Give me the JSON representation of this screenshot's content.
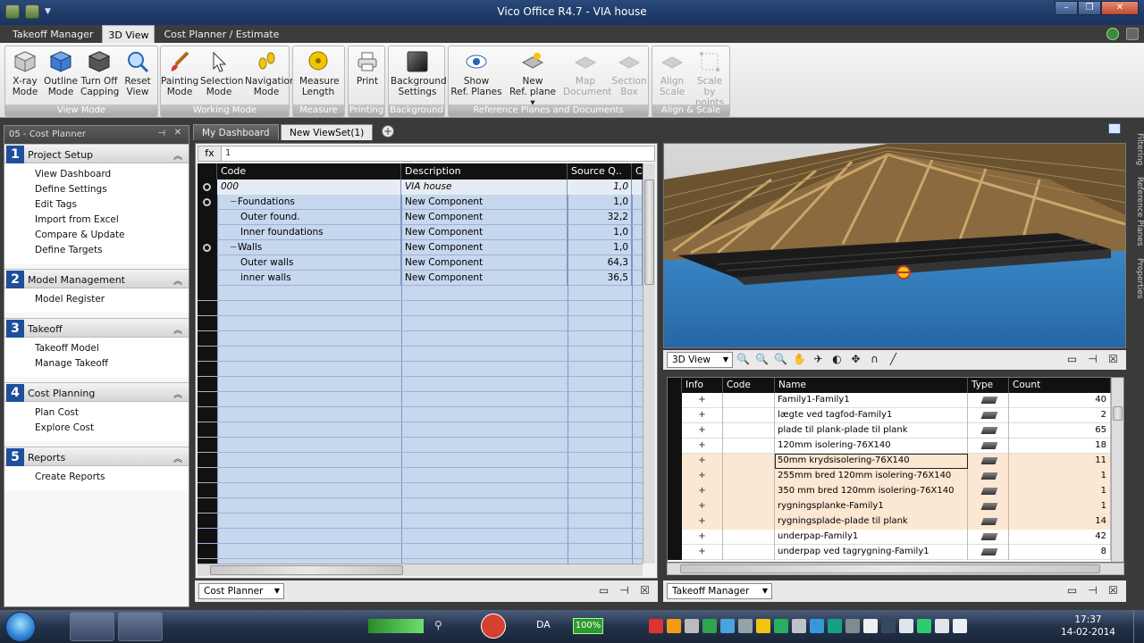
{
  "window": {
    "title": "Vico Office R4.7 - VIA house"
  },
  "menu_tabs": [
    {
      "label": "Takeoff Manager"
    },
    {
      "label": "3D View"
    },
    {
      "label": "Cost Planner / Estimate"
    }
  ],
  "ribbon": {
    "groups": [
      {
        "label": "View Mode",
        "buttons": [
          {
            "line1": "X-ray",
            "line2": "Mode",
            "icon": "xray-cube-icon"
          },
          {
            "line1": "Outline",
            "line2": "Mode",
            "icon": "outline-cube-icon"
          },
          {
            "line1": "Turn Off",
            "line2": "Capping",
            "icon": "capping-cube-icon"
          },
          {
            "line1": "Reset",
            "line2": "View",
            "icon": "reset-view-icon"
          }
        ]
      },
      {
        "label": "Working Mode",
        "buttons": [
          {
            "line1": "Painting",
            "line2": "Mode",
            "icon": "paintbrush-icon"
          },
          {
            "line1": "Selection",
            "line2": "Mode",
            "icon": "cursor-arrow-icon"
          },
          {
            "line1": "Navigation",
            "line2": "Mode",
            "icon": "footprints-icon"
          }
        ]
      },
      {
        "label": "Measure",
        "buttons": [
          {
            "line1": "Measure",
            "line2": "Length",
            "icon": "tape-measure-icon"
          }
        ]
      },
      {
        "label": "Printing",
        "buttons": [
          {
            "line1": "Print",
            "line2": "",
            "icon": "printer-icon"
          }
        ]
      },
      {
        "label": "Background",
        "buttons": [
          {
            "line1": "Background",
            "line2": "Settings",
            "icon": "background-swatch-icon"
          }
        ]
      },
      {
        "label": "Reference Planes and Documents",
        "buttons": [
          {
            "line1": "Show",
            "line2": "Ref. Planes",
            "icon": "eye-icon"
          },
          {
            "line1": "New",
            "line2": "Ref. plane ▾",
            "icon": "new-plane-icon"
          },
          {
            "line1": "Map",
            "line2": "Document",
            "icon": "map-document-icon",
            "disabled": true
          },
          {
            "line1": "Section",
            "line2": "Box",
            "icon": "section-box-icon",
            "disabled": true
          }
        ]
      },
      {
        "label": "Align & Scale",
        "buttons": [
          {
            "line1": "Align",
            "line2": "Scale",
            "icon": "align-icon",
            "disabled": true
          },
          {
            "line1": "Scale by",
            "line2": "points",
            "icon": "scale-points-icon",
            "disabled": true
          }
        ]
      }
    ]
  },
  "left_panel": {
    "title": "05 - Cost Planner",
    "sections": [
      {
        "num": "1",
        "title": "Project Setup",
        "items": [
          "View Dashboard",
          "Define Settings",
          "Edit Tags",
          "Import from Excel",
          "Compare & Update",
          "Define Targets"
        ]
      },
      {
        "num": "2",
        "title": "Model Management",
        "items": [
          "Model Register"
        ]
      },
      {
        "num": "3",
        "title": "Takeoff",
        "items": [
          "Takeoff Model",
          "Manage Takeoff"
        ]
      },
      {
        "num": "4",
        "title": "Cost Planning",
        "items": [
          "Plan Cost",
          "Explore Cost"
        ]
      },
      {
        "num": "5",
        "title": "Reports",
        "items": [
          "Create Reports"
        ]
      }
    ]
  },
  "center": {
    "tabs": [
      {
        "label": "My Dashboard"
      },
      {
        "label": "New ViewSet(1)"
      }
    ],
    "formula": {
      "label": "fx",
      "value": "1"
    },
    "columns": [
      "Code",
      "Description",
      "Source Q..",
      "C"
    ],
    "rows": [
      {
        "code": "000",
        "desc": "VIA house",
        "qty": "1,0",
        "marker": true,
        "italic": true,
        "indent": 0
      },
      {
        "code": "Foundations",
        "desc": "New Component",
        "qty": "1,0",
        "marker": true,
        "indent": 1,
        "expander": "−"
      },
      {
        "code": "Outer found.",
        "desc": "New Component",
        "qty": "32,2",
        "marker": false,
        "indent": 2
      },
      {
        "code": "Inner foundations",
        "desc": "New Component",
        "qty": "1,0",
        "marker": false,
        "indent": 2
      },
      {
        "code": "Walls",
        "desc": "New Component",
        "qty": "1,0",
        "marker": true,
        "indent": 1,
        "expander": "−"
      },
      {
        "code": "Outer walls",
        "desc": "New Component",
        "qty": "64,3",
        "marker": false,
        "indent": 2
      },
      {
        "code": "inner walls",
        "desc": "New Component",
        "qty": "36,5",
        "marker": false,
        "indent": 2
      }
    ],
    "bottom_combo": "Cost Planner"
  },
  "viewer": {
    "toolbar_combo": "3D View"
  },
  "right_grid": {
    "columns": [
      "Info",
      "Code",
      "Name",
      "Type",
      "Count"
    ],
    "rows": [
      {
        "name": "Family1-Family1",
        "count": "40"
      },
      {
        "name": "lægte ved tagfod-Family1",
        "count": "2"
      },
      {
        "name": "plade til plank-plade til plank",
        "count": "65"
      },
      {
        "name": "120mm isolering-76X140",
        "count": "18"
      },
      {
        "name": "50mm krydsisolering-76X140",
        "count": "11",
        "selected": true
      },
      {
        "name": "255mm bred 120mm isolering-76X140",
        "count": "1",
        "highlight": true
      },
      {
        "name": "350 mm bred 120mm isolering-76X140",
        "count": "1",
        "highlight": true
      },
      {
        "name": "rygningsplanke-Family1",
        "count": "1",
        "highlight": true
      },
      {
        "name": "rygningsplade-plade til plank",
        "count": "14",
        "highlight": true
      },
      {
        "name": "underpap-Family1",
        "count": "42"
      },
      {
        "name": "underpap ved tagrygning-Family1",
        "count": "8"
      }
    ],
    "bottom_combo": "Takeoff Manager"
  },
  "side_tabs": [
    "Filtering",
    "Reference Planes",
    "Properties"
  ],
  "taskbar": {
    "language": "DA",
    "battery": "100%",
    "time": "17:37",
    "date": "14-02-2014"
  },
  "colors": {
    "grid_blue": "#c6d7ee",
    "accent_blue": "#1f4f9c",
    "highlight_row": "#fbe7d2"
  }
}
